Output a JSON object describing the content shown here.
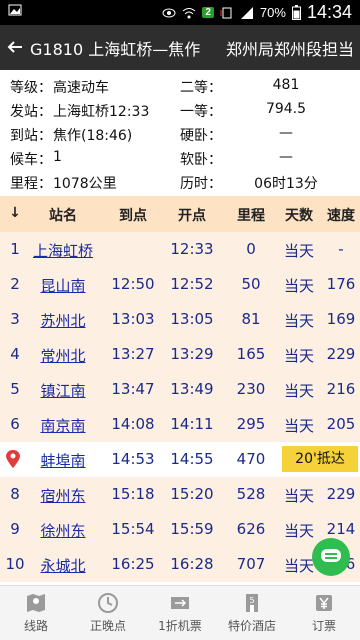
{
  "status_bar": {
    "battery_percent": "70%",
    "time": "14:34",
    "badge": "2",
    "icons": [
      "image-icon",
      "eye-icon",
      "wifi-icon",
      "sim-badge",
      "vibrate-icon",
      "signal-icon",
      "battery-icon"
    ]
  },
  "header": {
    "title": "G1810 上海虹桥—焦作",
    "duty": "郑州局郑州段担当"
  },
  "info": [
    {
      "k1": "等级：",
      "v1": "高速动车",
      "k2": "二等：",
      "v2": "481"
    },
    {
      "k1": "发站：",
      "v1": "上海虹桥12:33",
      "k2": "一等：",
      "v2": "794.5"
    },
    {
      "k1": "到站：",
      "v1": "焦作(18:46)",
      "k2": "硬卧：",
      "v2": "—"
    },
    {
      "k1": "候车：",
      "v1": "1",
      "k2": "软卧：",
      "v2": "—"
    },
    {
      "k1": "里程：",
      "v1": "1078公里",
      "k2": "历时：",
      "v2": "06时13分"
    }
  ],
  "table": {
    "headers": {
      "index": "↓",
      "station": "站名",
      "arrive": "到点",
      "depart": "开点",
      "mileage": "里程",
      "day": "天数",
      "speed": "速度"
    },
    "rows": [
      {
        "idx": "1",
        "station": "上海虹桥",
        "arrive": "",
        "depart": "12:33",
        "mileage": "0",
        "day": "当天",
        "speed": "-"
      },
      {
        "idx": "2",
        "station": "昆山南",
        "arrive": "12:50",
        "depart": "12:52",
        "mileage": "50",
        "day": "当天",
        "speed": "176"
      },
      {
        "idx": "3",
        "station": "苏州北",
        "arrive": "13:03",
        "depart": "13:05",
        "mileage": "81",
        "day": "当天",
        "speed": "169"
      },
      {
        "idx": "4",
        "station": "常州北",
        "arrive": "13:27",
        "depart": "13:29",
        "mileage": "165",
        "day": "当天",
        "speed": "229"
      },
      {
        "idx": "5",
        "station": "镇江南",
        "arrive": "13:47",
        "depart": "13:49",
        "mileage": "230",
        "day": "当天",
        "speed": "216"
      },
      {
        "idx": "6",
        "station": "南京南",
        "arrive": "14:08",
        "depart": "14:11",
        "mileage": "295",
        "day": "当天",
        "speed": "205"
      },
      {
        "idx": "",
        "station": "蚌埠南",
        "arrive": "14:53",
        "depart": "14:55",
        "mileage": "470",
        "day": "",
        "speed": "",
        "delay": "20'抵达"
      },
      {
        "idx": "8",
        "station": "宿州东",
        "arrive": "15:18",
        "depart": "15:20",
        "mileage": "528",
        "day": "当天",
        "speed": "229"
      },
      {
        "idx": "9",
        "station": "徐州东",
        "arrive": "15:54",
        "depart": "15:59",
        "mileage": "626",
        "day": "当天",
        "speed": "214"
      },
      {
        "idx": "10",
        "station": "永城北",
        "arrive": "16:25",
        "depart": "16:28",
        "mileage": "707",
        "day": "当天",
        "speed": "186"
      }
    ]
  },
  "tabs": [
    {
      "label": "线路",
      "icon": "map-icon"
    },
    {
      "label": "正晚点",
      "icon": "clock-icon"
    },
    {
      "label": "1折机票",
      "icon": "ticket-icon"
    },
    {
      "label": "特价酒店",
      "icon": "hotel-icon"
    },
    {
      "label": "订票",
      "icon": "yen-icon"
    }
  ],
  "colors": {
    "header_bg": "#2e2e2e",
    "table_head_bg": "#fde2c4",
    "row_alt": "#fdf0e2",
    "delay_bg": "#f6d23a",
    "fab": "#2ebd4e"
  }
}
